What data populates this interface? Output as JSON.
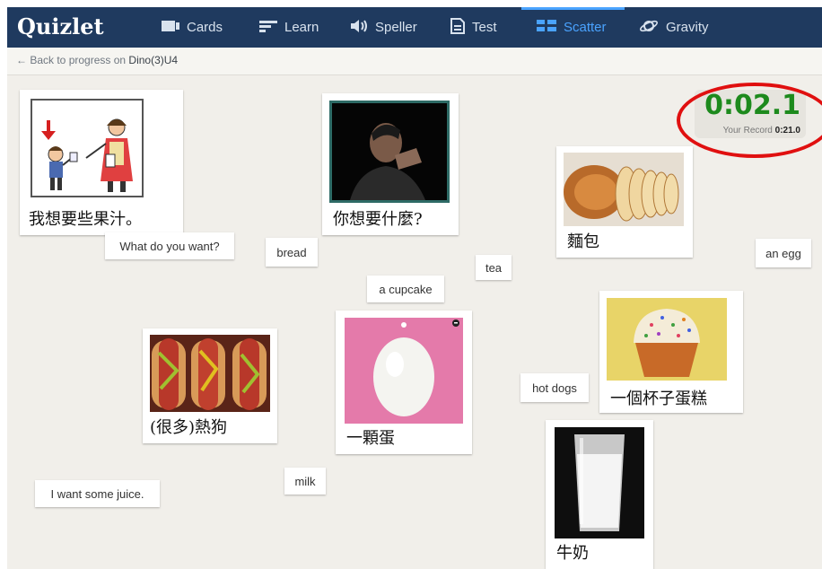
{
  "app": {
    "logo": "Quizlet"
  },
  "nav": [
    {
      "label": "Cards",
      "icon": "cards-icon"
    },
    {
      "label": "Learn",
      "icon": "learn-icon"
    },
    {
      "label": "Speller",
      "icon": "speaker-icon"
    },
    {
      "label": "Test",
      "icon": "document-icon"
    },
    {
      "label": "Scatter",
      "icon": "scatter-icon",
      "active": true
    },
    {
      "label": "Gravity",
      "icon": "planet-icon"
    }
  ],
  "subheader": {
    "back_prefix": "← Back to progress on",
    "set_name": "Dino(3)U4"
  },
  "timer": {
    "time": "0:02.1",
    "record_label": "Your Record",
    "record_value": "0:21.0"
  },
  "image_cards": [
    {
      "zh": "我想要些果汁。",
      "image": "kids-juice-illustration"
    },
    {
      "zh": "你想要什麼?",
      "image": "thinking-man-photo"
    },
    {
      "zh": "麵包",
      "image": "bread-photo"
    },
    {
      "zh": "一個杯子蛋糕",
      "image": "cupcake-photo"
    },
    {
      "zh": "(很多)熱狗",
      "image": "hotdogs-photo"
    },
    {
      "zh": "一顆蛋",
      "image": "egg-photo"
    },
    {
      "zh": "牛奶",
      "image": "milk-glass-photo"
    }
  ],
  "word_tiles": [
    {
      "text": "What do you want?"
    },
    {
      "text": "bread"
    },
    {
      "text": "tea"
    },
    {
      "text": "an egg"
    },
    {
      "text": "a cupcake"
    },
    {
      "text": "hot dogs"
    },
    {
      "text": "milk"
    },
    {
      "text": "I want some juice."
    }
  ],
  "colors": {
    "topbar": "#1f3a5f",
    "active": "#4aa3ff",
    "timer": "#1d8a1d",
    "highlight": "#e01010",
    "background": "#f1efea"
  }
}
